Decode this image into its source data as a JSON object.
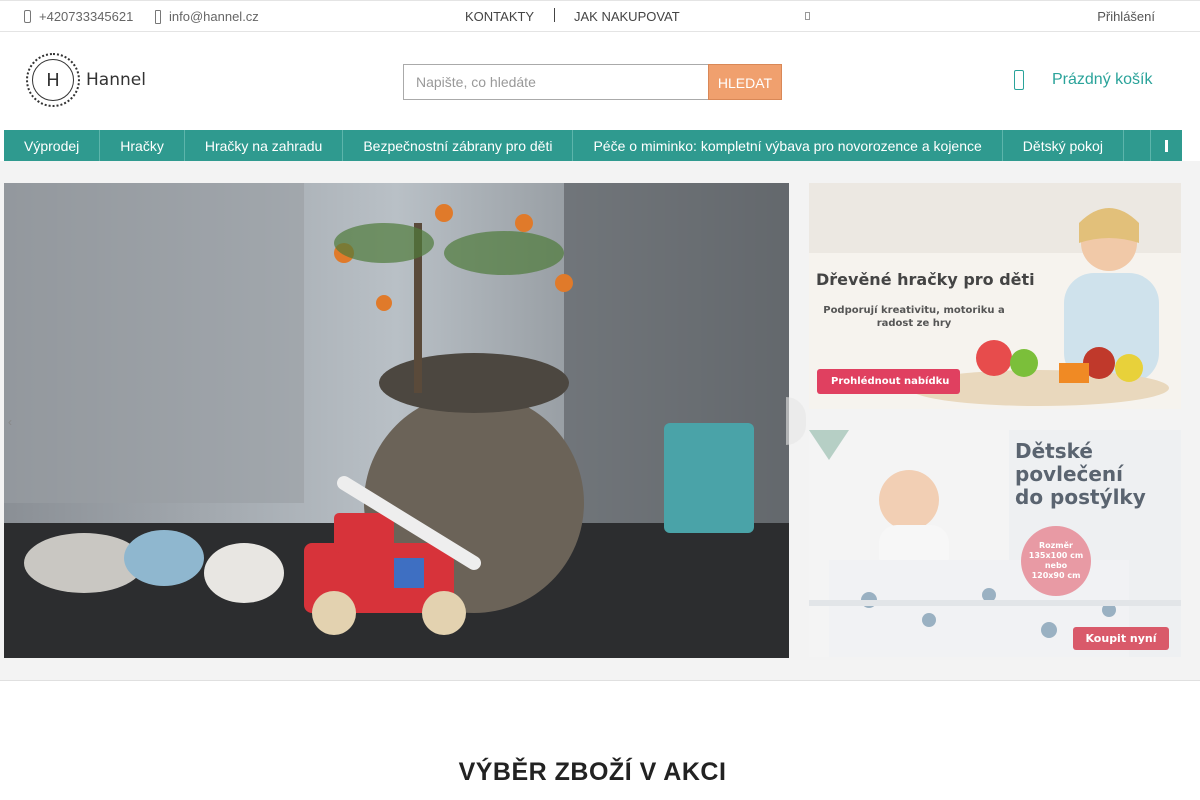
{
  "topbar": {
    "phone": "+420733345621",
    "email": "info@hannel.cz",
    "links": [
      "KONTAKTY",
      "JAK NAKUPOVAT"
    ],
    "login": "Přihlášení"
  },
  "header": {
    "logo_letter": "H",
    "logo_text": "Hannel",
    "search_placeholder": "Napište, co hledáte",
    "search_button": "HLEDAT",
    "cart_label": "Prázdný košík"
  },
  "nav": {
    "items": [
      "Výprodej",
      "Hračky",
      "Hračky na zahradu",
      "Bezpečnostní zábrany pro děti",
      "Péče o miminko: kompletní výbava pro novorozence a kojence",
      "Dětský pokoj"
    ]
  },
  "banners": {
    "side1": {
      "title": "Dřevěné hračky pro děti",
      "subtitle": "Podporují kreativitu, motoriku a radost ze hry",
      "button": "Prohlédnout nabídku"
    },
    "side2": {
      "title_line1": "Dětské",
      "title_line2": "povlečení",
      "title_line3": "do postýlky",
      "size_label": "Rozměr",
      "size1": "135x100 cm",
      "size_or": "nebo",
      "size2": "120x90 cm",
      "button": "Koupit nyní"
    }
  },
  "section": {
    "title": "VÝBĚR ZBOŽÍ V AKCI"
  },
  "colors": {
    "accent": "#2f9a8f",
    "search_button": "#f0a06e",
    "cart_text": "#2aa39a"
  }
}
